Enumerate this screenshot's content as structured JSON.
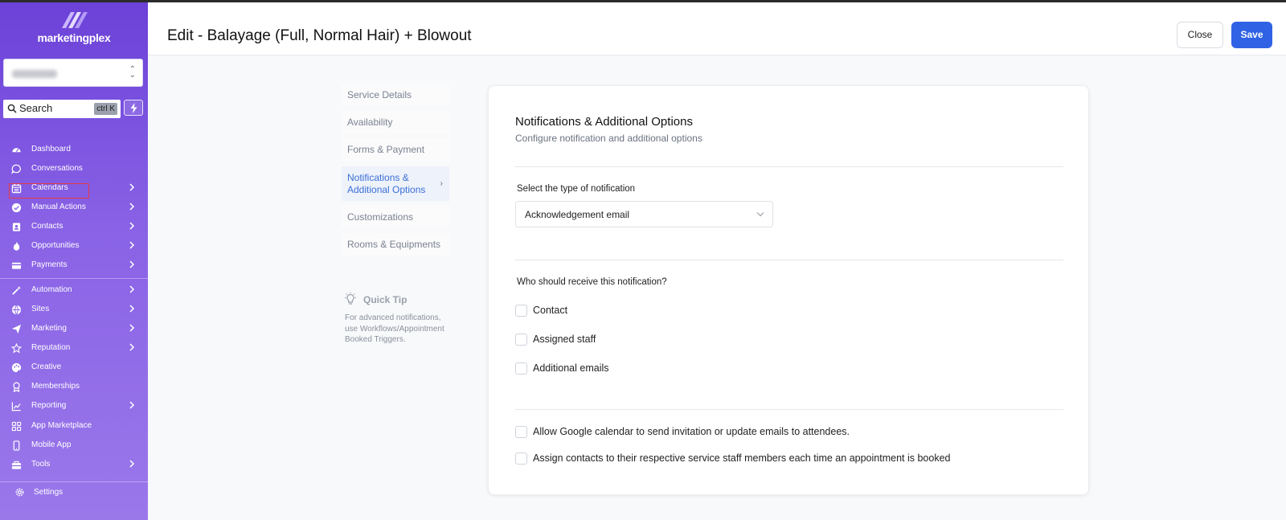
{
  "brand": {
    "logo_text": "marketingplex"
  },
  "search": {
    "label": "Search",
    "shortcut": "ctrl K"
  },
  "sidebar": {
    "items": [
      {
        "label": "Dashboard",
        "icon": "dashboard-icon",
        "chevron": false
      },
      {
        "label": "Conversations",
        "icon": "chat-icon",
        "chevron": false
      },
      {
        "label": "Calendars",
        "icon": "calendar-icon",
        "chevron": true
      },
      {
        "label": "Manual Actions",
        "icon": "check-circle-icon",
        "chevron": true
      },
      {
        "label": "Contacts",
        "icon": "contacts-icon",
        "chevron": true
      },
      {
        "label": "Opportunities",
        "icon": "flame-icon",
        "chevron": true
      },
      {
        "label": "Payments",
        "icon": "card-icon",
        "chevron": true
      },
      {
        "label": "Automation",
        "icon": "wand-icon",
        "chevron": true
      },
      {
        "label": "Sites",
        "icon": "globe-icon",
        "chevron": true
      },
      {
        "label": "Marketing",
        "icon": "send-icon",
        "chevron": true
      },
      {
        "label": "Reputation",
        "icon": "star-icon",
        "chevron": true
      },
      {
        "label": "Creative",
        "icon": "palette-icon",
        "chevron": false
      },
      {
        "label": "Memberships",
        "icon": "badge-icon",
        "chevron": false
      },
      {
        "label": "Reporting",
        "icon": "chart-icon",
        "chevron": true
      },
      {
        "label": "App Marketplace",
        "icon": "grid-icon",
        "chevron": false
      },
      {
        "label": "Mobile App",
        "icon": "phone-icon",
        "chevron": false
      },
      {
        "label": "Tools",
        "icon": "toolbox-icon",
        "chevron": true
      }
    ],
    "settings_label": "Settings"
  },
  "header": {
    "title": "Edit - Balayage (Full, Normal Hair) + Blowout",
    "close_label": "Close",
    "save_label": "Save"
  },
  "tabs": [
    {
      "label": "Service Details",
      "active": false
    },
    {
      "label": "Availability",
      "active": false
    },
    {
      "label": "Forms & Payment",
      "active": false
    },
    {
      "label": "Notifications & Additional Options",
      "active": true
    },
    {
      "label": "Customizations",
      "active": false
    },
    {
      "label": "Rooms & Equipments",
      "active": false
    }
  ],
  "quick_tip": {
    "title": "Quick Tip",
    "text": "For advanced notifications, use Workflows/Appointment Booked Triggers."
  },
  "panel": {
    "title": "Notifications & Additional Options",
    "subtitle": "Configure notification and additional options",
    "type_label": "Select the type of notification",
    "type_value": "Acknowledgement email",
    "recipients_label": "Who should receive this notification?",
    "recipients": [
      "Contact",
      "Assigned staff",
      "Additional emails"
    ],
    "options": [
      "Allow Google calendar to send invitation or update emails to attendees.",
      "Assign contacts to their respective service staff members each time an appointment is booked"
    ]
  },
  "colors": {
    "accent": "#2f62e4",
    "sidebar_top": "#6b41d8",
    "sidebar_bottom": "#9a78ea",
    "active_tab": "#3a6fd8"
  }
}
